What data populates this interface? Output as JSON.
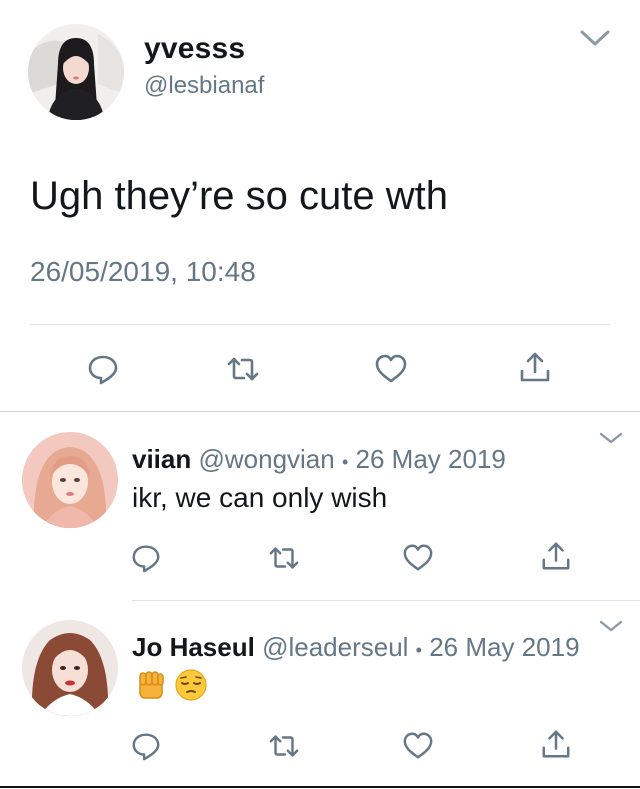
{
  "main_tweet": {
    "display_name": "yvesss",
    "handle": "@lesbianaf",
    "text": "Ugh they’re so cute wth",
    "timestamp": "26/05/2019, 10:48",
    "icons": [
      "chevron-down-icon",
      "reply-icon",
      "retweet-icon",
      "like-icon",
      "share-icon"
    ]
  },
  "replies": [
    {
      "display_name": "viian",
      "handle": "@wongvian",
      "separator": "•",
      "date": "26 May 2019",
      "text": "ikr, we can only wish"
    },
    {
      "display_name": "Jo Haseul",
      "handle": "@leaderseul",
      "separator": "•",
      "date": "26 May 2019",
      "emojis": [
        "✊",
        "😔"
      ]
    }
  ],
  "colors": {
    "text": "#14171a",
    "secondary": "#657786",
    "divider": "#dfe3e6",
    "icon": "#657786"
  }
}
